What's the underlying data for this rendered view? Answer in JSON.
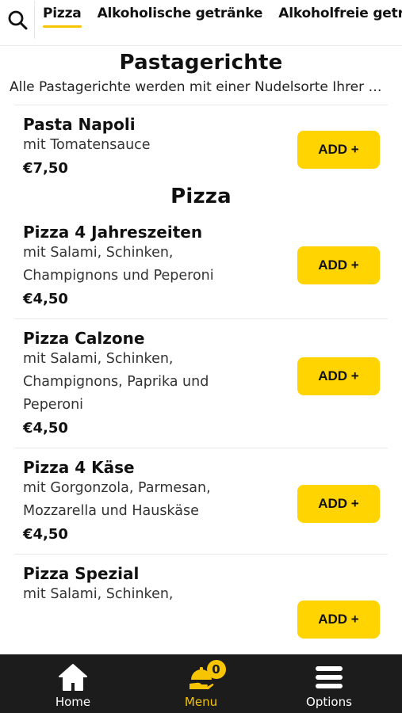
{
  "tabs": [
    {
      "label": "Pizza",
      "active": true
    },
    {
      "label": "Alkoholische getränke",
      "active": false
    },
    {
      "label": "Alkoholfreie getränke",
      "active": false
    }
  ],
  "sections": [
    {
      "title": "Pastagerichte",
      "description": "Alle Pastagerichte werden mit einer Nudelsorte Ihrer Wahl serviert",
      "items": [
        {
          "name": "Pasta Napoli",
          "desc_lines": [
            "mit Tomatensauce"
          ],
          "price": "€7,50",
          "button": "ADD +"
        }
      ]
    },
    {
      "title": "Pizza",
      "items": [
        {
          "name": "Pizza 4 Jahreszeiten",
          "desc_lines": [
            "mit Salami, Schinken,",
            "Champignons und Peperoni"
          ],
          "price": "€4,50",
          "button": "ADD +"
        },
        {
          "name": "Pizza Calzone",
          "desc_lines": [
            "mit Salami, Schinken,",
            "Champignons, Paprika und",
            "Peperoni"
          ],
          "price": "€4,50",
          "button": "ADD +"
        },
        {
          "name": "Pizza 4 Käse",
          "desc_lines": [
            "mit Gorgonzola, Parmesan,",
            "Mozzarella und Hauskäse"
          ],
          "price": "€4,50",
          "button": "ADD +"
        },
        {
          "name": "Pizza Spezial",
          "desc_lines": [
            "mit Salami, Schinken,"
          ],
          "price": "",
          "button": "ADD +"
        }
      ]
    }
  ],
  "bottom_nav": [
    {
      "label": "Home",
      "icon": "home-icon",
      "active": false
    },
    {
      "label": "Menu",
      "icon": "menu-dish-icon",
      "active": true,
      "badge": "0"
    },
    {
      "label": "Options",
      "icon": "hamburger-icon",
      "active": false
    }
  ],
  "colors": {
    "accent": "#ffd400",
    "nav_background": "#1c1c1c",
    "active_nav": "#f6c400"
  }
}
